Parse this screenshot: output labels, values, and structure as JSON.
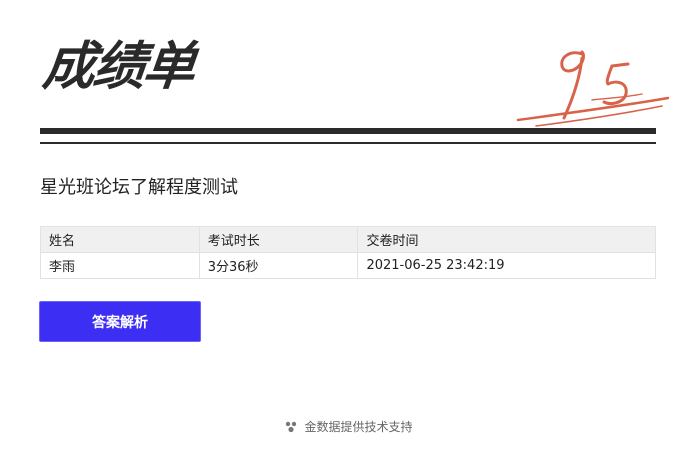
{
  "header": {
    "title": "成绩单",
    "score": "95",
    "score_color": "#d9624a"
  },
  "exam": {
    "name": "星光班论坛了解程度测试"
  },
  "table": {
    "headers": [
      "姓名",
      "考试时长",
      "交卷时间"
    ],
    "row": [
      "李雨",
      "3分36秒",
      "2021-06-25 23:42:19"
    ]
  },
  "actions": {
    "answer_label": "答案解析",
    "answer_color": "#3d2ef4"
  },
  "footer": {
    "text": "金数据提供技术支持",
    "icon": "jinshuju-logo-icon"
  }
}
